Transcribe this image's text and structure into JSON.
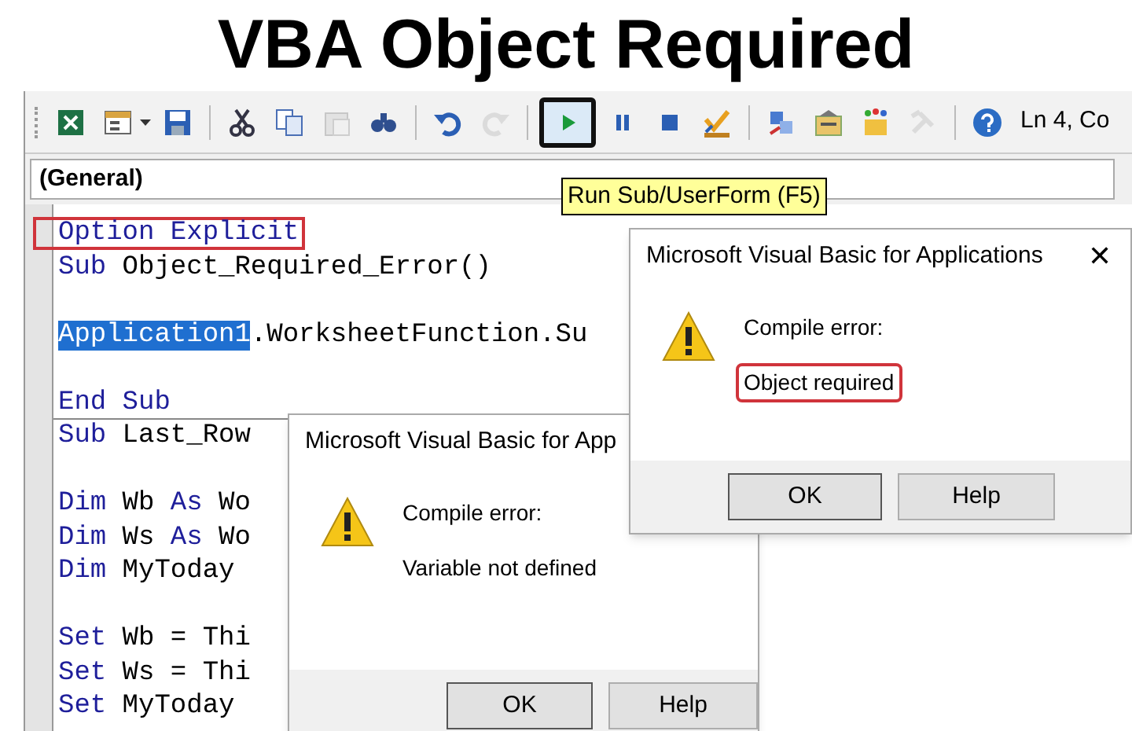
{
  "title": "VBA Object Required",
  "toolbar": {
    "buttons": [
      {
        "kind": "excel",
        "disabled": false,
        "highlighted": false
      },
      {
        "kind": "userform",
        "disabled": false,
        "highlighted": false
      },
      {
        "kind": "save",
        "disabled": false,
        "highlighted": false
      },
      {
        "kind": "sep"
      },
      {
        "kind": "cut",
        "disabled": false,
        "highlighted": false
      },
      {
        "kind": "copy",
        "disabled": false,
        "highlighted": false
      },
      {
        "kind": "paste",
        "disabled": true,
        "highlighted": false
      },
      {
        "kind": "find",
        "disabled": false,
        "highlighted": false
      },
      {
        "kind": "sep"
      },
      {
        "kind": "undo",
        "disabled": false,
        "highlighted": false
      },
      {
        "kind": "redo",
        "disabled": true,
        "highlighted": false
      },
      {
        "kind": "sep"
      },
      {
        "kind": "run",
        "disabled": false,
        "highlighted": true
      },
      {
        "kind": "pause",
        "disabled": false,
        "highlighted": false
      },
      {
        "kind": "stop",
        "disabled": false,
        "highlighted": false
      },
      {
        "kind": "design",
        "disabled": false,
        "highlighted": false
      },
      {
        "kind": "sep"
      },
      {
        "kind": "project",
        "disabled": false,
        "highlighted": false
      },
      {
        "kind": "properties",
        "disabled": false,
        "highlighted": false
      },
      {
        "kind": "browser",
        "disabled": false,
        "highlighted": false
      },
      {
        "kind": "toolbox",
        "disabled": true,
        "highlighted": false
      },
      {
        "kind": "sep"
      },
      {
        "kind": "help",
        "disabled": false,
        "highlighted": false
      }
    ],
    "position": "Ln 4, Co"
  },
  "object_box": {
    "value": "(General)"
  },
  "tooltip": "Run Sub/UserForm (F5)",
  "code": {
    "lines": [
      {
        "segments": [
          {
            "text": "Option Explicit",
            "kind": "keyword",
            "selected": false
          }
        ],
        "highlighted": true,
        "divider_after": false
      },
      {
        "segments": [
          {
            "text": "Sub",
            "kind": "keyword",
            "selected": false
          },
          {
            "text": " Object_Required_Error()",
            "kind": "plain",
            "selected": false
          }
        ],
        "highlighted": false,
        "divider_after": false
      },
      {
        "divider_after": false
      },
      {
        "segments": [
          {
            "text": "Application1",
            "kind": "plain",
            "selected": true
          },
          {
            "text": ".WorksheetFunction.Su",
            "kind": "plain",
            "selected": false
          }
        ],
        "highlighted": false,
        "divider_after": false
      },
      {
        "divider_after": false
      },
      {
        "segments": [
          {
            "text": "End Sub",
            "kind": "keyword",
            "selected": false
          }
        ],
        "highlighted": false,
        "divider_after": true
      },
      {
        "segments": [
          {
            "text": "Sub",
            "kind": "keyword",
            "selected": false
          },
          {
            "text": " Last_Row",
            "kind": "plain",
            "selected": false
          }
        ],
        "highlighted": false,
        "divider_after": false
      },
      {
        "divider_after": false
      },
      {
        "segments": [
          {
            "text": "Dim",
            "kind": "keyword",
            "selected": false
          },
          {
            "text": " Wb ",
            "kind": "plain",
            "selected": false
          },
          {
            "text": "As",
            "kind": "keyword",
            "selected": false
          },
          {
            "text": " Wo",
            "kind": "plain",
            "selected": false
          }
        ],
        "highlighted": false,
        "divider_after": false
      },
      {
        "segments": [
          {
            "text": "Dim",
            "kind": "keyword",
            "selected": false
          },
          {
            "text": " Ws ",
            "kind": "plain",
            "selected": false
          },
          {
            "text": "As",
            "kind": "keyword",
            "selected": false
          },
          {
            "text": " Wo",
            "kind": "plain",
            "selected": false
          }
        ],
        "highlighted": false,
        "divider_after": false
      },
      {
        "segments": [
          {
            "text": "Dim",
            "kind": "keyword",
            "selected": false
          },
          {
            "text": " MyToday",
            "kind": "plain",
            "selected": false
          }
        ],
        "highlighted": false,
        "divider_after": false
      },
      {
        "divider_after": false
      },
      {
        "segments": [
          {
            "text": "Set",
            "kind": "keyword",
            "selected": false
          },
          {
            "text": " Wb = Thi",
            "kind": "plain",
            "selected": false
          }
        ],
        "highlighted": false,
        "divider_after": false
      },
      {
        "segments": [
          {
            "text": "Set",
            "kind": "keyword",
            "selected": false
          },
          {
            "text": " Ws = Thi",
            "kind": "plain",
            "selected": false
          }
        ],
        "highlighted": false,
        "divider_after": false
      },
      {
        "segments": [
          {
            "text": "Set",
            "kind": "keyword",
            "selected": false
          },
          {
            "text": " MyToday",
            "kind": "plain",
            "selected": false
          }
        ],
        "highlighted": false,
        "divider_after": false
      }
    ]
  },
  "dialogs": [
    {
      "title": "Microsoft Visual Basic for App",
      "heading": "Compile error:",
      "message": "Variable not defined",
      "message_highlighted": false,
      "buttons": [
        "OK",
        "Help"
      ]
    },
    {
      "title": "Microsoft Visual Basic for Applications",
      "close_label": "✕",
      "heading": "Compile error:",
      "message": "Object required",
      "message_highlighted": true,
      "buttons": [
        "OK",
        "Help"
      ]
    }
  ]
}
